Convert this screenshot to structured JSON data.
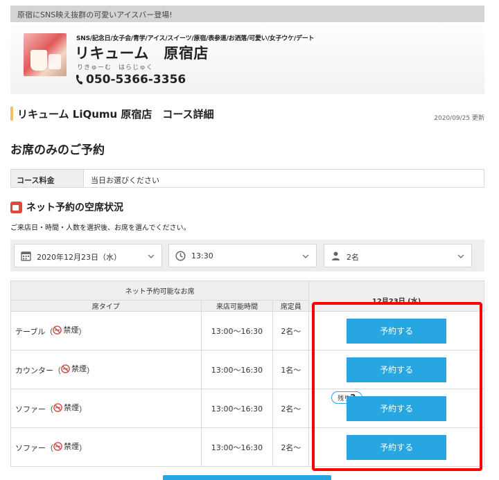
{
  "banner": {
    "text": "原宿にSNS映え抜群の可愛いアイスバー登場!"
  },
  "store": {
    "tags": "SNS/記念日/女子会/青学/アイス/スイーツ/原宿/表参道/お洒落/可愛い/女子ウケ/デート",
    "name": "リキューム　原宿店",
    "kana": "りきゅーむ　はらじゅく",
    "phone": "050-5366-3356"
  },
  "page": {
    "title": "リキューム LiQumu 原宿店　コース詳細",
    "updated": "2020/09/25 更新",
    "course_heading": "お席のみのご予約"
  },
  "fee": {
    "label": "コース料金",
    "value": "当日お選びください"
  },
  "availability": {
    "heading": "ネット予約の空席状況",
    "instruction": "ご来店日・時間・人数を選択後、お席を選んでください。"
  },
  "filters": {
    "date": "2020年12月23日（水）",
    "time": "13:30",
    "people": "2名"
  },
  "table": {
    "group_header": "ネット予約可能なお席",
    "col_seat": "席タイプ",
    "col_time": "来店可能時間",
    "col_cap": "席定員",
    "date_header": "12月23日 (水)",
    "reserve_label": "予約する",
    "rows": [
      {
        "seat": "テーブル",
        "smoking": "禁煙",
        "time": "13:00～16:30",
        "cap": "2名～"
      },
      {
        "seat": "カウンター",
        "smoking": "禁煙",
        "time": "13:00～16:30",
        "cap": "1名～"
      },
      {
        "seat": "ソファー",
        "smoking": "禁煙",
        "time": "13:00～16:30",
        "cap": "2名～",
        "badge_prefix": "残り",
        "badge_count": "2"
      },
      {
        "seat": "ソファー",
        "smoking": "禁煙",
        "time": "13:00～16:30",
        "cap": "2名～"
      }
    ]
  },
  "colors": {
    "accent_blue": "#27a6e1",
    "highlight_red": "#ff0000",
    "title_accent": "#f5bf6e"
  }
}
